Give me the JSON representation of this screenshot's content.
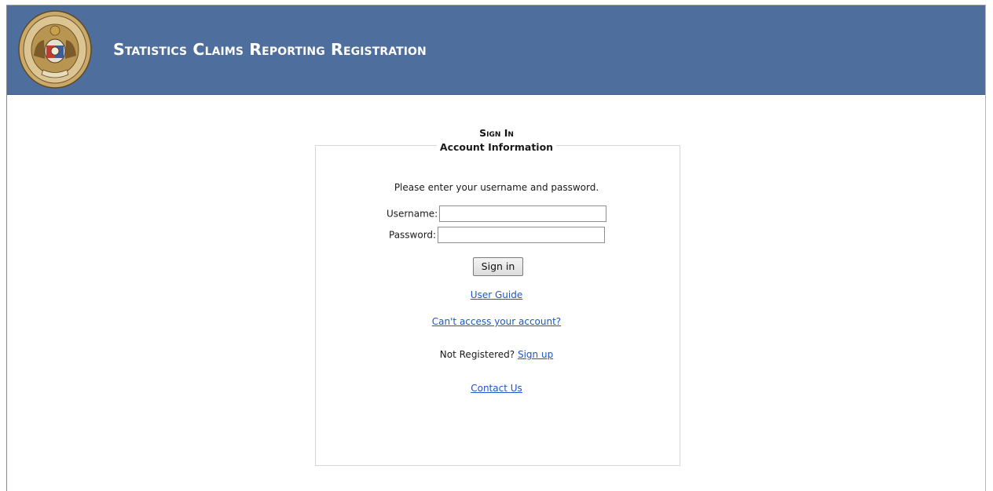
{
  "header": {
    "title": "Statistics Claims Reporting Registration",
    "seal_alt": "Great Seal of the State of Missouri"
  },
  "signin": {
    "heading": "Sign In",
    "legend": "Account Information",
    "instructions": "Please enter your username and password.",
    "username_label": "Username:",
    "password_label": "Password:",
    "username_value": "",
    "password_value": "",
    "button_label": "Sign in"
  },
  "links": {
    "user_guide": "User Guide",
    "cant_access": "Can't access your account?",
    "not_registered": "Not Registered?",
    "sign_up": "Sign up",
    "contact_us": "Contact Us"
  },
  "colors": {
    "header_bg": "#4e6e9e",
    "link": "#1e55c8"
  },
  "icons": {
    "seal": "state-seal-logo"
  }
}
